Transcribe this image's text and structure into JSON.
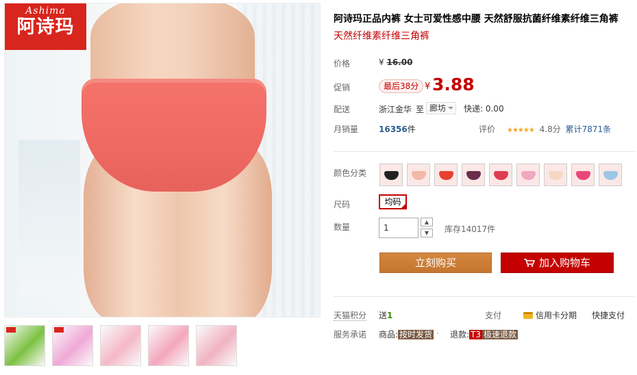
{
  "brand": {
    "logo_en": "Ashima",
    "logo_cn": "阿诗玛"
  },
  "product": {
    "title": "阿诗玛正品内裤 女士可爱性感中腰 天然舒服抗菌纤维素纤维三角裤",
    "subtitle": "天然纤维素纤维三角裤"
  },
  "price": {
    "label": "价格",
    "currency": "¥",
    "original": "16.00"
  },
  "promo": {
    "label": "促销",
    "badge": "最后38分",
    "currency": "¥",
    "price": "3.88"
  },
  "delivery": {
    "label": "配送",
    "from": "浙江金华",
    "to_label": "至",
    "to_city": "廊坊",
    "shipping": "快递: 0.00"
  },
  "sales": {
    "label": "月销量",
    "count": "16356",
    "unit": "件",
    "rating_label": "评价",
    "stars": "★★★★★",
    "score": "4.8分",
    "reviews": "累计7871条"
  },
  "color": {
    "label": "颜色分类",
    "swatches": [
      "#222222",
      "#f3b8a8",
      "#e8402f",
      "#6a2f4a",
      "#e03c52",
      "#f2a7c0",
      "#f6d7c4",
      "#e9477a",
      "#9cc7e6"
    ]
  },
  "size": {
    "label": "尺码",
    "value": "均码"
  },
  "quantity": {
    "label": "数量",
    "value": "1",
    "stock": "库存14017件"
  },
  "actions": {
    "buy": "立刻购买",
    "cart": "加入购物车"
  },
  "points": {
    "label": "天猫积分",
    "prefix": "送",
    "value": "1",
    "pay_label": "支付",
    "credit": "信用卡分期",
    "fast": "快捷支付"
  },
  "service": {
    "label": "服务承诺",
    "goods_label": "商品:",
    "goods_tag": "按时发货",
    "refund_label": "退款:",
    "refund_badge": "T3",
    "refund_tag": "极速退款"
  },
  "thumbnails": [
    {
      "color": "#7cc142"
    },
    {
      "color": "#f0a9d6"
    },
    {
      "color": "#f5b8c8"
    },
    {
      "color": "#f4a7bd"
    },
    {
      "color": "#f1b3c2"
    }
  ]
}
